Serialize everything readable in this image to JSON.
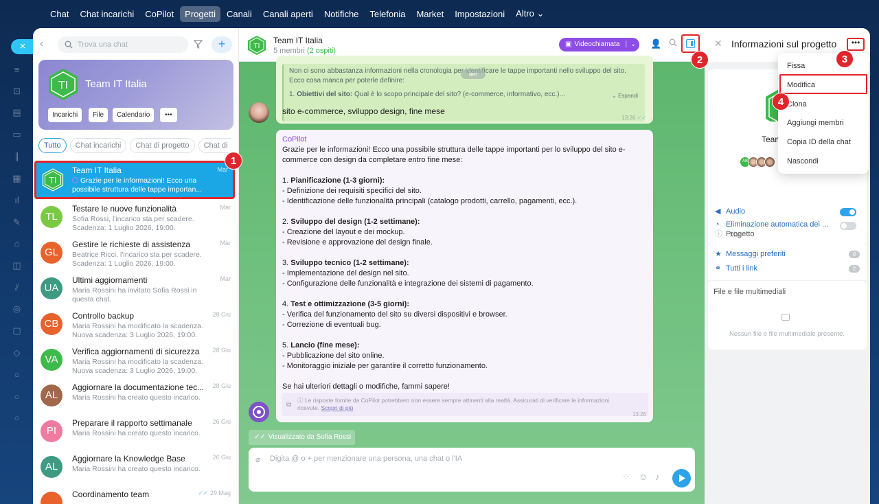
{
  "topnav": [
    "Chat",
    "Chat incarichi",
    "CoPilot",
    "Progetti",
    "Canali",
    "Canali aperti",
    "Notifiche",
    "Telefonia",
    "Market",
    "Impostazioni",
    "Altro ⌄"
  ],
  "topnav_active": 3,
  "search": {
    "placeholder": "Trova una chat"
  },
  "project_card": {
    "initials": "TI",
    "title": "Team IT Italia",
    "buttons": [
      "Incarichi",
      "File",
      "Calendario",
      "•••"
    ]
  },
  "filters": [
    "Tutto",
    "Chat incarichi",
    "Chat di progetto",
    "Chat di"
  ],
  "chats": [
    {
      "initials": "TI",
      "name": "Team IT Italia",
      "time": "Mar",
      "preview": "Grazie per le informazioni! Ecco una possibile struttura delle tappe importan...",
      "color": "#3dba49"
    },
    {
      "initials": "TL",
      "name": "Testare le nuove funzionalità",
      "time": "Mar",
      "preview": "Sofia Rossi, l'incarico sta per scadere. Scadenza: 1 Luglio 2026, 19:00.",
      "color": "#7ac943"
    },
    {
      "initials": "GL",
      "name": "Gestire le richieste di assistenza",
      "time": "Mar",
      "preview": "Beatrice Ricci, l'incarico sta per scadere. Scadenza: 1 Luglio 2026, 19:00.",
      "color": "#e8622c"
    },
    {
      "initials": "UA",
      "name": "Ultimi aggiornamenti",
      "time": "Mar",
      "preview": "Maria Rossini ha invitato Sofia Rossi in questa chat.",
      "color": "#3e9a83"
    },
    {
      "initials": "CB",
      "name": "Controllo backup",
      "time": "28 Giu",
      "preview": "Maria Rossini ha modificato la scadenza. Nuova scadenza: 3 Luglio 2026, 19:00.",
      "color": "#e8622c"
    },
    {
      "initials": "VA",
      "name": "Verifica aggiornamenti di sicurezza",
      "time": "28 Giu",
      "preview": "Maria Rossini ha modificato la scadenza. Nuova scadenza: 3 Luglio 2026, 19:00.",
      "color": "#3dba49"
    },
    {
      "initials": "AL",
      "name": "Aggiornare la documentazione tec...",
      "time": "28 Giu",
      "preview": "Maria Rossini ha creato questo incarico.",
      "color": "#a0674a"
    },
    {
      "initials": "PI",
      "name": "Preparare il rapporto settimanale",
      "time": "26 Giu",
      "preview": "Maria Rossini ha creato questo incarico.",
      "color": "#ef7ba0"
    },
    {
      "initials": "AL",
      "name": "Aggiornare la Knowledge Base",
      "time": "26 Giu",
      "preview": "Maria Rossini ha creato questo incarico.",
      "color": "#3e9a83"
    },
    {
      "initials": "",
      "name": "Coordinamento team",
      "time": "29 Mag",
      "preview": "",
      "color": "#e8622c"
    }
  ],
  "chat_header": {
    "title": "Team IT Italia",
    "members": "5 membri",
    "guests": "(2 ospiti)",
    "video_button": "Videochiamata"
  },
  "messages": {
    "quote_text": "Non ci sono abbastanza informazioni nella cronologia per identificare le tappe importanti nello sviluppo del sito. Ecco cosa manca per poterle definire:",
    "quote_item_num": "1.",
    "quote_item_bold": "Obiettivi del sito:",
    "quote_item_rest": "Qual è lo scopo principale del sito? (e-commerce, informativo, ecc.)...",
    "expand": "Espandi",
    "date_chip": "ieri",
    "user_text": "sito e-commerce, sviluppo design, fine mese",
    "user_time": "13:26",
    "copilot_name": "CoPilot",
    "copilot_intro": "Grazie per le informazioni! Ecco una possibile struttura delle tappe importanti per lo sviluppo del sito e-commerce con design da completare entro fine mese:",
    "sections": [
      {
        "num": "1.",
        "title": "Pianificazione (1-3 giorni):",
        "lines": [
          "- Definizione dei requisiti specifici del sito.",
          "- Identificazione delle funzionalità principali (catalogo prodotti, carrello, pagamenti, ecc.)."
        ]
      },
      {
        "num": "2.",
        "title": "Sviluppo del design (1-2 settimane):",
        "lines": [
          "- Creazione del layout e dei mockup.",
          "- Revisione e approvazione del design finale."
        ]
      },
      {
        "num": "3.",
        "title": "Sviluppo tecnico (1-2 settimane):",
        "lines": [
          "- Implementazione del design nel sito.",
          "- Configurazione delle funzionalità e integrazione dei sistemi di pagamento."
        ]
      },
      {
        "num": "4.",
        "title": "Test e ottimizzazione (3-5 giorni):",
        "lines": [
          "- Verifica del funzionamento del sito su diversi dispositivi e browser.",
          "- Correzione di eventuali bug."
        ]
      },
      {
        "num": "5.",
        "title": "Lancio (fine mese):",
        "lines": [
          "- Pubblicazione del sito online.",
          "- Monitoraggio iniziale per garantire il corretto funzionamento."
        ]
      }
    ],
    "copilot_outro": "Se hai ulteriori dettagli o modifiche, fammi sapere!",
    "disclaimer": "Le risposte fornite da CoPilot potrebbero non essere sempre attinenti alla realtà. Assicurati di verificare le informazioni ricevute.",
    "disclaimer_link": "Scopri di più",
    "copilot_time": "13:26",
    "seen": "Visualizzato da Sofia Rossi"
  },
  "composer": {
    "placeholder": "Digita @ o + per menzionare una persona, una chat o l'IA"
  },
  "side_panel": {
    "title": "Informazioni sul progetto",
    "name": "Team",
    "audio": "Audio",
    "auto_delete": "Eliminazione automatica dei ...",
    "auto_delete_value": "Mai",
    "project": "Progetto",
    "favorites": "Messaggi preferiti",
    "favorites_count": "0",
    "links": "Tutti i link",
    "links_count": "2",
    "files_title": "File e file multimediali",
    "files_empty": "Nessun file o file multimediale presente."
  },
  "menu": [
    "Fissa",
    "Modifica",
    "Clona",
    "Aggiungi membri",
    "Copia ID della chat",
    "Nascondi"
  ],
  "steps": [
    "1",
    "2",
    "3",
    "4"
  ],
  "colors": {
    "accent": "#2fa2e8",
    "highlight": "#e0262c",
    "copilot": "#8d4ce6",
    "green": "#3dba49"
  }
}
